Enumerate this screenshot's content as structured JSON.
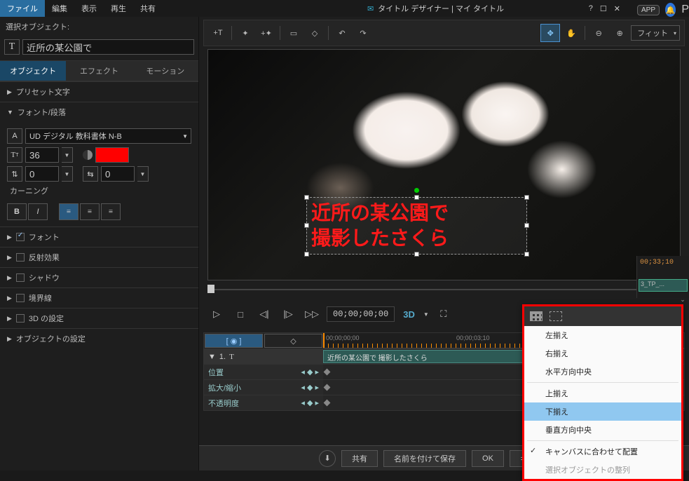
{
  "menubar": {
    "file": "ファイル",
    "edit": "編集",
    "view": "表示",
    "play": "再生",
    "share": "共有"
  },
  "window": {
    "title": "タイトル デザイナー | マイ タイトル",
    "help": "?",
    "min": "☐",
    "close": "✕"
  },
  "app": {
    "badge": "APP",
    "notif": "🔔",
    "p": "P"
  },
  "leftpanel": {
    "sel_label": "選択オブジェクト:",
    "sel_value": "近所の某公園で",
    "tabs": {
      "object": "オブジェクト",
      "effect": "エフェクト",
      "motion": "モーション"
    },
    "preset": "プリセット文字",
    "fontsec": "フォント/段落",
    "font_name": "UD デジタル 教科書体 N-B",
    "size": "36",
    "spacing1": "0",
    "spacing2": "0",
    "kerning": "カーニング",
    "sections": {
      "font": "フォント",
      "reflect": "反射効果",
      "shadow": "シャドウ",
      "border": "境界線",
      "threeD": "3D の設定",
      "objset": "オブジェクトの設定"
    }
  },
  "toolbar": {
    "fit": "フィット"
  },
  "title_text": {
    "line1": "近所の某公園で",
    "line2": "撮影したさくら"
  },
  "playback": {
    "tc": "00;00;00;00",
    "threeD": "3D"
  },
  "timeline": {
    "t0": "00;00;00;00",
    "t1": "00;00;03;10",
    "track_main": "近所の某公園で 撮影したさくら",
    "rows": {
      "pos": "位置",
      "scale": "拡大/縮小",
      "opacity": "不透明度"
    },
    "num": "1."
  },
  "ext": {
    "tc": "00;33;10",
    "clip": "3_TP_..."
  },
  "context": {
    "left": "左揃え",
    "right": "右揃え",
    "hcenter": "水平方向中央",
    "top": "上揃え",
    "bottom": "下揃え",
    "vcenter": "垂直方向中央",
    "canvas": "キャンバスに合わせて配置",
    "selalign": "選択オブジェクトの整列"
  },
  "bottombar": {
    "share": "共有",
    "saveas": "名前を付けて保存",
    "ok": "OK",
    "cancel": "キャンセル"
  }
}
